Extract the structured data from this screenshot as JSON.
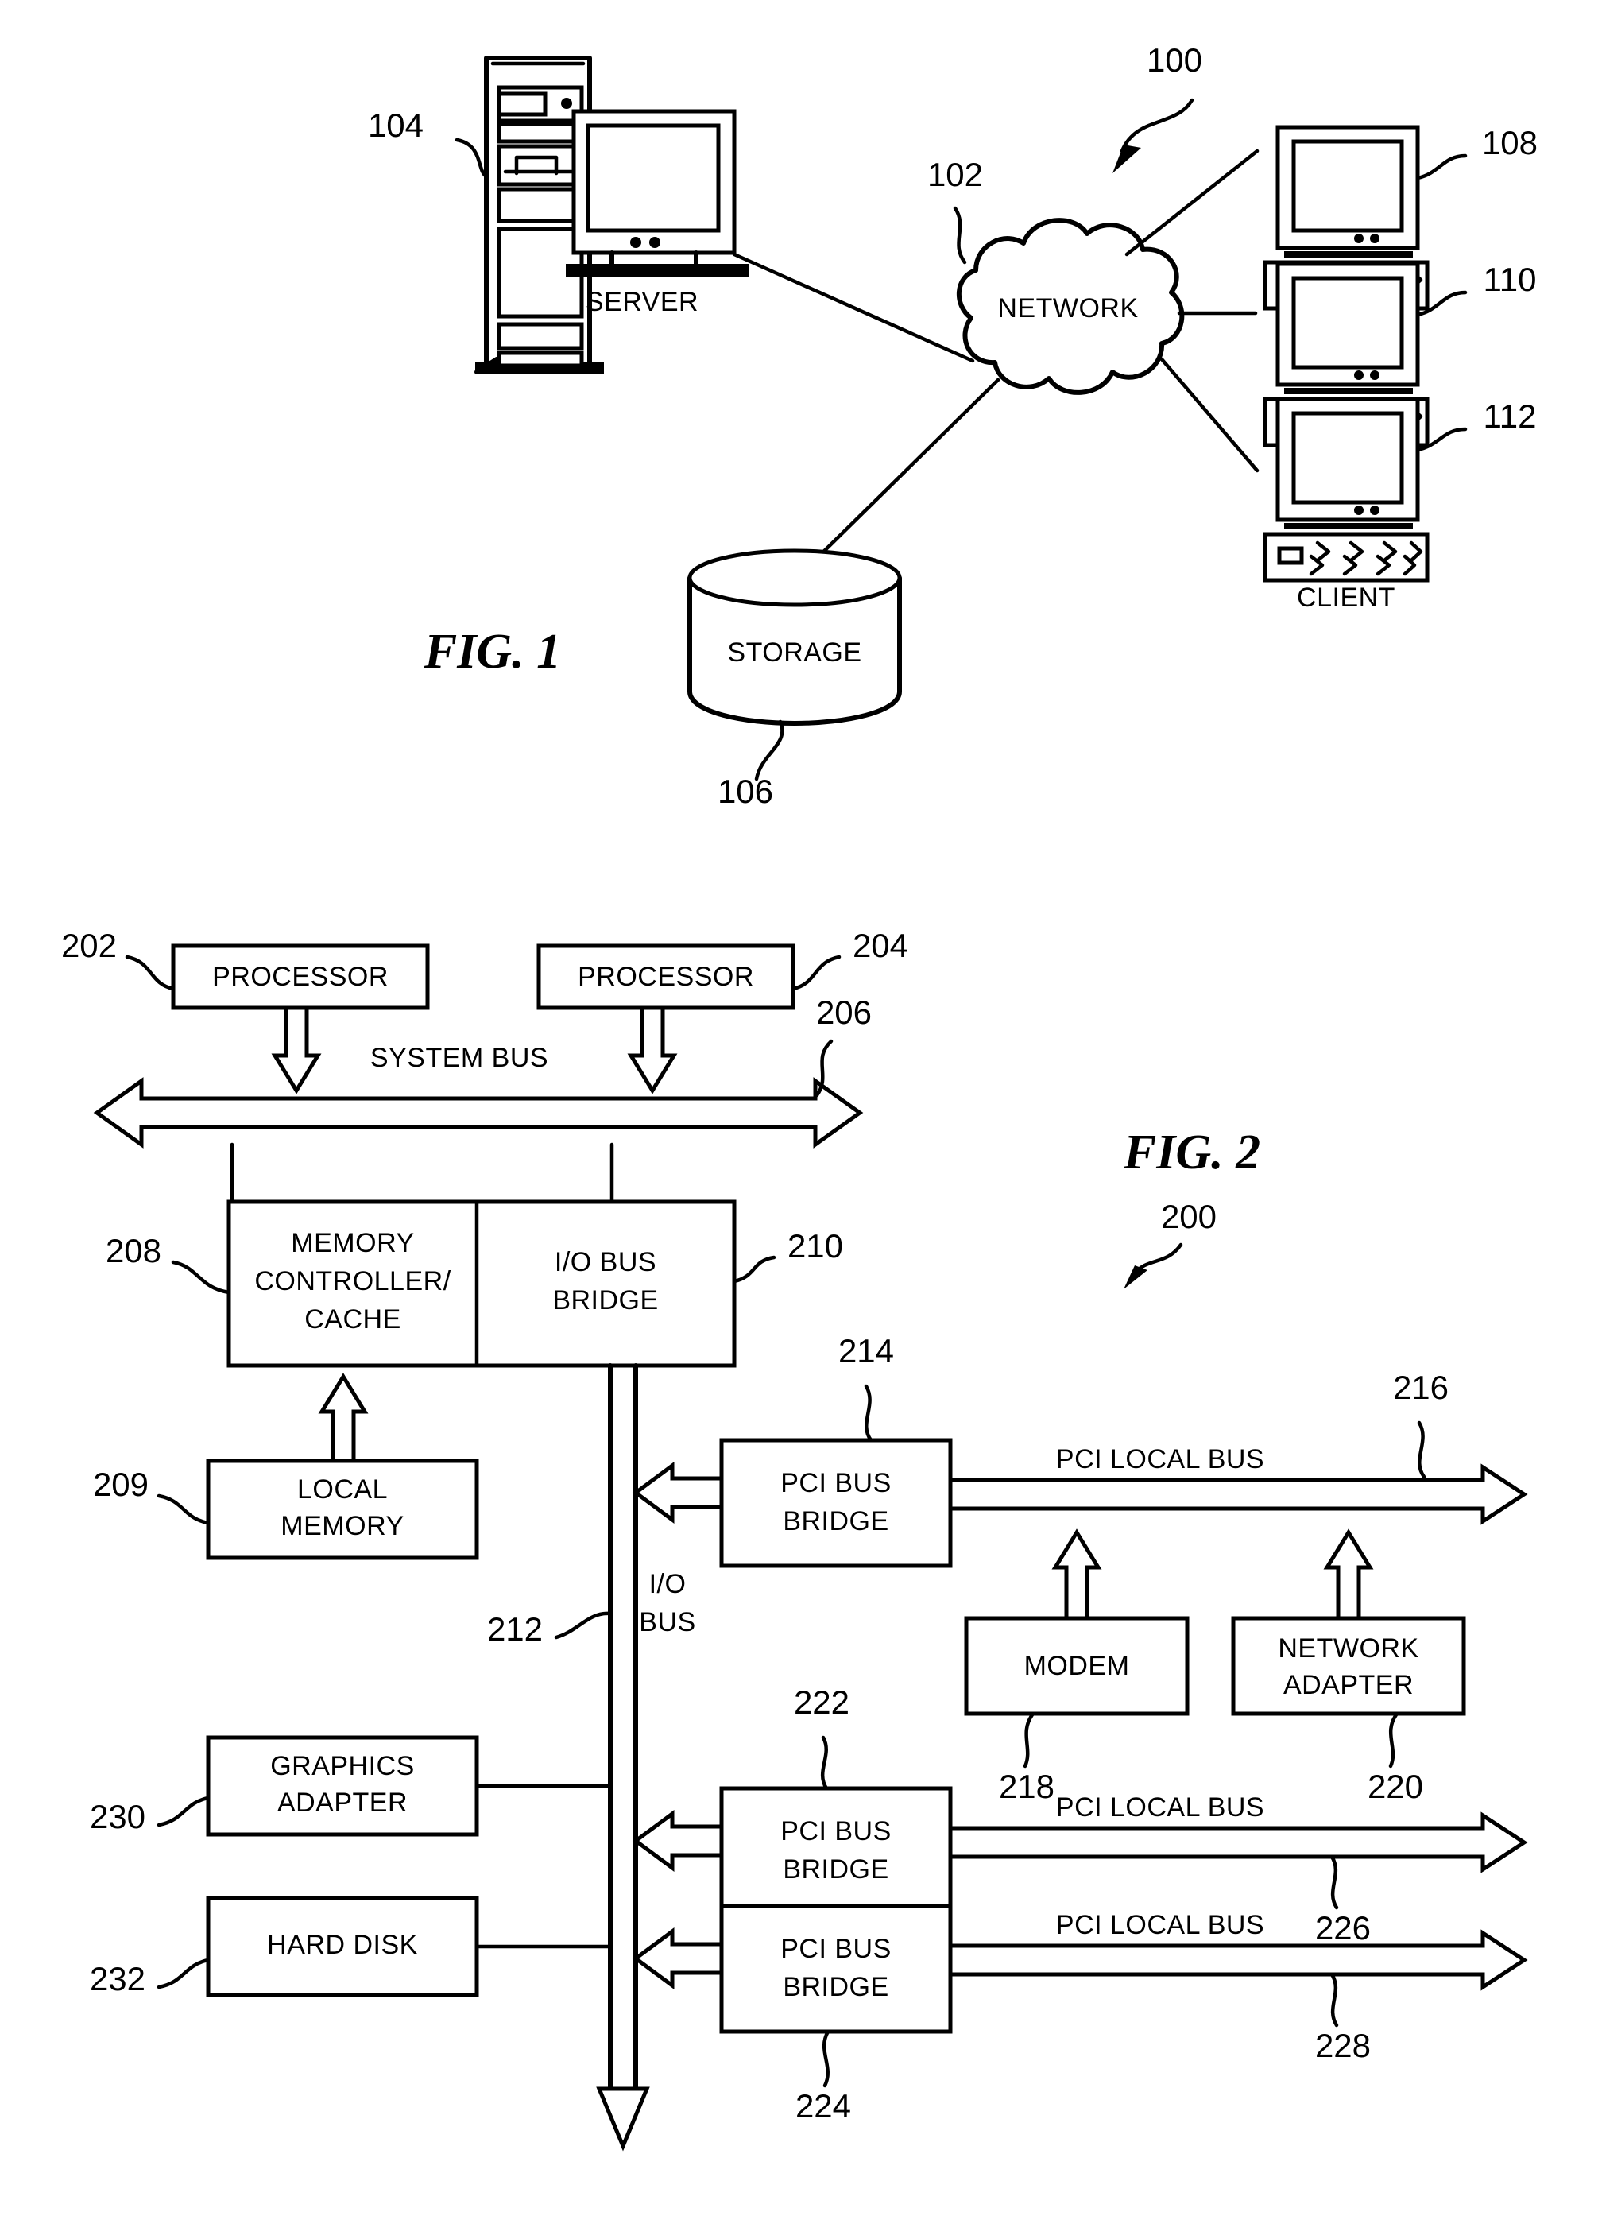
{
  "document": {
    "type": "patent-drawing-sheet",
    "figures": [
      "FIG. 1",
      "FIG. 2"
    ]
  },
  "fig1": {
    "caption": "FIG. 1",
    "system_ref": "100",
    "nodes": {
      "server": {
        "label": "SERVER",
        "ref": "104"
      },
      "network": {
        "label": "NETWORK",
        "ref": "102"
      },
      "storage": {
        "label": "STORAGE",
        "ref": "106"
      },
      "client1": {
        "label": "CLIENT",
        "ref": "108"
      },
      "client2": {
        "label": "CLIENT",
        "ref": "110"
      },
      "client3": {
        "label": "CLIENT",
        "ref": "112"
      }
    }
  },
  "fig2": {
    "caption": "FIG. 2",
    "system_ref": "200",
    "blocks": {
      "processor1": {
        "label": "PROCESSOR",
        "ref": "202"
      },
      "processor2": {
        "label": "PROCESSOR",
        "ref": "204"
      },
      "system_bus": {
        "label": "SYSTEM BUS",
        "ref": "206"
      },
      "memory_controller": {
        "label_line1": "MEMORY",
        "label_line2": "CONTROLLER/",
        "label_line3": "CACHE",
        "ref": "208"
      },
      "io_bus_bridge": {
        "label_line1": "I/O BUS",
        "label_line2": "BRIDGE",
        "ref": "210"
      },
      "local_memory": {
        "label_line1": "LOCAL",
        "label_line2": "MEMORY",
        "ref": "209"
      },
      "io_bus": {
        "label_line1": "I/O",
        "label_line2": "BUS",
        "ref": "212"
      },
      "pci_bridge_1": {
        "label_line1": "PCI BUS",
        "label_line2": "BRIDGE",
        "ref": "214"
      },
      "pci_local_bus_1": {
        "label": "PCI LOCAL BUS",
        "ref": "216"
      },
      "modem": {
        "label": "MODEM",
        "ref": "218"
      },
      "network_adapter": {
        "label_line1": "NETWORK",
        "label_line2": "ADAPTER",
        "ref": "220"
      },
      "pci_bridge_2": {
        "label_line1": "PCI BUS",
        "label_line2": "BRIDGE",
        "ref": "222"
      },
      "pci_local_bus_2": {
        "label": "PCI LOCAL BUS",
        "ref": "226"
      },
      "pci_bridge_3": {
        "label_line1": "PCI BUS",
        "label_line2": "BRIDGE",
        "ref": "224"
      },
      "pci_local_bus_3": {
        "label": "PCI LOCAL BUS",
        "ref": "228"
      },
      "graphics_adapter": {
        "label_line1": "GRAPHICS",
        "label_line2": "ADAPTER",
        "ref": "230"
      },
      "hard_disk": {
        "label": "HARD DISK",
        "ref": "232"
      }
    }
  },
  "colors": {
    "ink": "#000000",
    "paper": "#ffffff"
  }
}
